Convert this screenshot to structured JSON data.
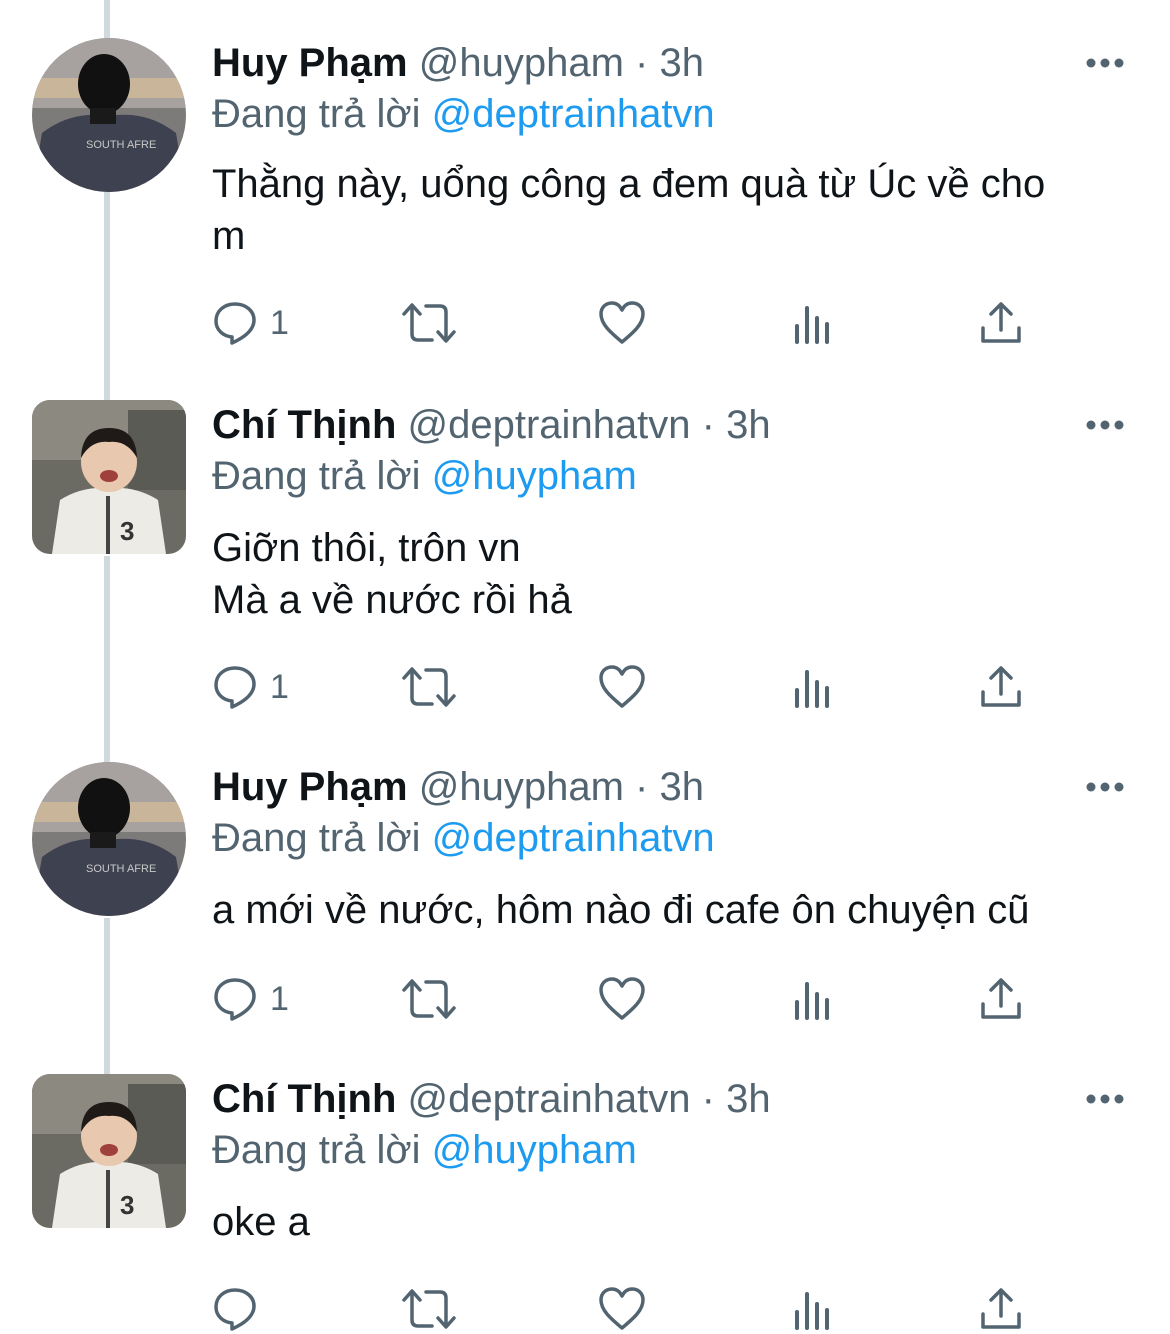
{
  "tweets": [
    {
      "name": "Huy Phạm",
      "handle": "@huypham",
      "separator": "·",
      "time": "3h",
      "reply_prefix": "Đang trả lời",
      "reply_to": "@deptrainhatvn",
      "text": "Thằng này, uổng công a đem quà từ Úc về cho\nm",
      "reply_count": "1",
      "avatar": "avatar-photo-hooded-person"
    },
    {
      "name": "Chí Thịnh",
      "handle": "@deptrainhatvn",
      "separator": "·",
      "time": "3h",
      "reply_prefix": "Đang trả lời",
      "reply_to": "@huypham",
      "text": "Giỡn thôi, trôn vn\nMà a về nước rồi hả",
      "reply_count": "1",
      "avatar": "avatar-photo-smiling-child"
    },
    {
      "name": "Huy Phạm",
      "handle": "@huypham",
      "separator": "·",
      "time": "3h",
      "reply_prefix": "Đang trả lời",
      "reply_to": "@deptrainhatvn",
      "text": "a mới về nước, hôm nào đi cafe ôn chuyện cũ",
      "reply_count": "1",
      "avatar": "avatar-photo-hooded-person"
    },
    {
      "name": "Chí Thịnh",
      "handle": "@deptrainhatvn",
      "separator": "·",
      "time": "3h",
      "reply_prefix": "Đang trả lời",
      "reply_to": "@huypham",
      "text": "oke a",
      "reply_count": "",
      "avatar": "avatar-photo-smiling-child"
    }
  ],
  "icons": {
    "reply": "reply-bubble-icon",
    "retweet": "retweet-icon",
    "like": "heart-icon",
    "views": "bar-chart-icon",
    "share": "share-upload-icon",
    "more": "more-dots-icon"
  },
  "colors": {
    "text": "#0f1419",
    "secondary": "#536471",
    "mention": "#1d9bf0",
    "thread_line": "#cfd9de"
  }
}
